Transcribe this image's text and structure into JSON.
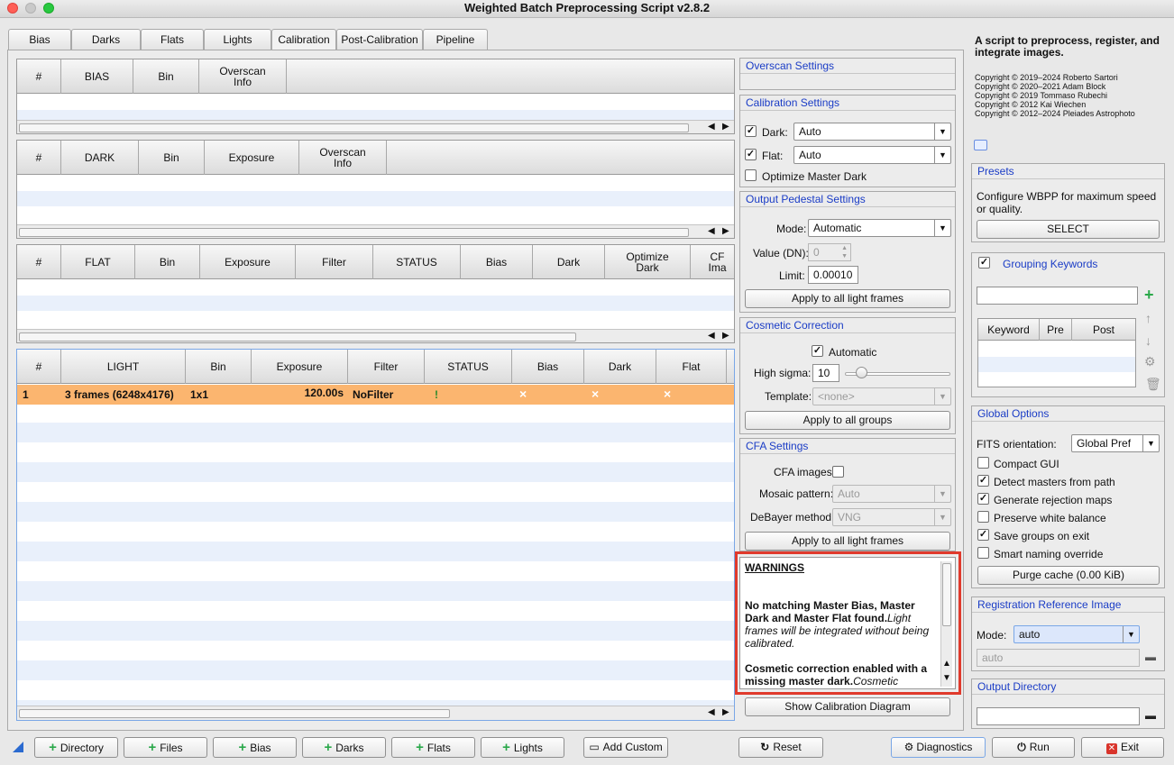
{
  "window": {
    "title": "Weighted Batch Preprocessing Script v2.8.2"
  },
  "tabs": [
    "Bias",
    "Darks",
    "Flats",
    "Lights",
    "Calibration",
    "Post-Calibration",
    "Pipeline"
  ],
  "bias_table": {
    "headers": [
      "#",
      "BIAS",
      "Bin",
      "Overscan\nInfo"
    ]
  },
  "dark_table": {
    "headers": [
      "#",
      "DARK",
      "Bin",
      "Exposure",
      "Overscan\nInfo"
    ]
  },
  "flat_table": {
    "headers": [
      "#",
      "FLAT",
      "Bin",
      "Exposure",
      "Filter",
      "STATUS",
      "Bias",
      "Dark",
      "Optimize\nDark",
      "CF\nIma"
    ]
  },
  "light_table": {
    "headers": [
      "#",
      "LIGHT",
      "Bin",
      "Exposure",
      "Filter",
      "STATUS",
      "Bias",
      "Dark",
      "Flat"
    ],
    "rows": [
      {
        "num": "1",
        "light": "3 frames (6248x4176)",
        "bin": "1x1",
        "exposure": "120.00s",
        "filter": "NoFilter",
        "status": "!",
        "bias": "×",
        "dark": "×",
        "flat": "×"
      }
    ],
    "row_color": "#fbb56f"
  },
  "overscan": {
    "title": "Overscan Settings"
  },
  "calibration": {
    "title": "Calibration Settings",
    "dark_label": "Dark:",
    "dark_value": "Auto",
    "dark_checked": true,
    "flat_label": "Flat:",
    "flat_value": "Auto",
    "flat_checked": true,
    "optimize_label": "Optimize Master Dark",
    "optimize_checked": false
  },
  "pedestal": {
    "title": "Output Pedestal Settings",
    "mode_label": "Mode:",
    "mode_value": "Automatic",
    "value_label": "Value (DN):",
    "value_value": "0",
    "limit_label": "Limit:",
    "limit_value": "0.00010",
    "apply_label": "Apply to all light frames"
  },
  "cosmetic": {
    "title": "Cosmetic Correction",
    "automatic_label": "Automatic",
    "automatic_checked": true,
    "sigma_label": "High sigma:",
    "sigma_value": "10",
    "template_label": "Template:",
    "template_value": "<none>",
    "apply_label": "Apply to all groups"
  },
  "cfa": {
    "title": "CFA Settings",
    "cfa_label": "CFA images:",
    "cfa_checked": false,
    "mosaic_label": "Mosaic pattern:",
    "mosaic_value": "Auto",
    "debayer_label": "DeBayer method:",
    "debayer_value": "VNG",
    "apply_label": "Apply to all light frames"
  },
  "warnings": {
    "heading": "WARNINGS",
    "w1_bold": "No matching Master Bias, Master Dark and Master Flat found.",
    "w1_italic": "Light frames will be integrated without being calibrated.",
    "w2_bold": "Cosmetic correction enabled with a missing master dark.",
    "w2_italic": "Cosmetic"
  },
  "show_diagram_label": "Show Calibration Diagram",
  "info": {
    "heading": "A script to preprocess, register, and integrate images.",
    "copyrights": [
      "Copyright © 2019–2024 Roberto Sartori",
      "Copyright © 2020–2021 Adam Block",
      "Copyright © 2019 Tommaso Rubechi",
      "Copyright © 2012 Kai Wiechen",
      "Copyright © 2012–2024 Pleiades Astrophoto"
    ]
  },
  "presets": {
    "title": "Presets",
    "text": "Configure WBPP for maximum speed or quality.",
    "select_label": "SELECT"
  },
  "grouping": {
    "title": "Grouping Keywords",
    "checked": true,
    "headers": [
      "Keyword",
      "Pre",
      "Post"
    ]
  },
  "global": {
    "title": "Global Options",
    "fits_label": "FITS orientation:",
    "fits_value": "Global Pref",
    "options": [
      {
        "label": "Compact GUI",
        "checked": false
      },
      {
        "label": "Detect masters from path",
        "checked": true
      },
      {
        "label": "Generate rejection maps",
        "checked": true
      },
      {
        "label": "Preserve white balance",
        "checked": false
      },
      {
        "label": "Save groups on exit",
        "checked": true
      },
      {
        "label": "Smart naming override",
        "checked": false
      }
    ],
    "purge_label": "Purge cache (0.00 KiB)"
  },
  "registration": {
    "title": "Registration Reference Image",
    "mode_label": "Mode:",
    "mode_value": "auto",
    "path_placeholder": "auto"
  },
  "output": {
    "title": "Output Directory",
    "value": ""
  },
  "bottom": {
    "add_buttons": [
      "Directory",
      "Files",
      "Bias",
      "Darks",
      "Flats",
      "Lights"
    ],
    "add_custom_label": "Add Custom",
    "reset_label": "Reset",
    "diagnostics_label": "Diagnostics",
    "run_label": "Run",
    "exit_label": "Exit"
  },
  "colors": {
    "accent": "#1a3cc6",
    "warning_border": "#e03a2c",
    "selected_row": "#fbb56f",
    "add_green": "#2aa84a",
    "exit_red": "#d9342b"
  }
}
